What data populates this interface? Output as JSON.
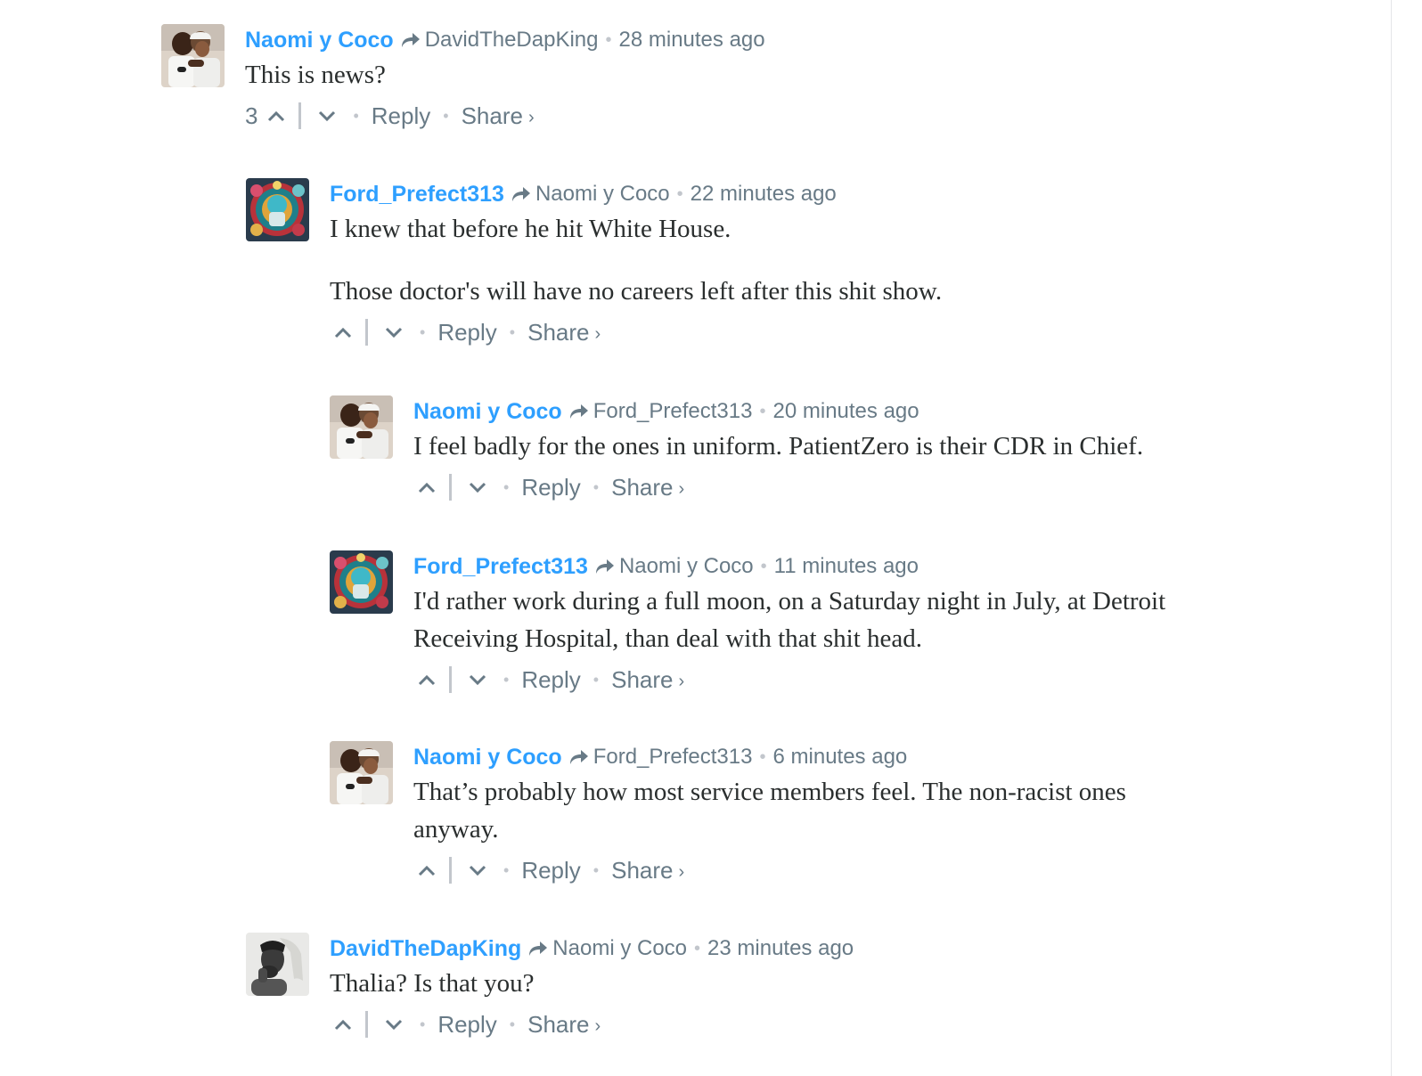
{
  "actions": {
    "reply_label": "Reply",
    "share_label": "Share",
    "share_chevron": "›",
    "separator_dot": "•",
    "upvote_icon": "chevron-up-icon",
    "downvote_icon": "chevron-down-icon"
  },
  "colors": {
    "author_link": "#2e9fff",
    "meta_gray": "#687a86",
    "body_text": "#2a2e2e",
    "divider": "#c2c6cc"
  },
  "comments": [
    {
      "author": "Naomi y Coco",
      "in_reply_to": "DavidTheDapKing",
      "time": "28 minutes ago",
      "paragraphs": [
        "This is news?"
      ],
      "votes": "3",
      "avatar": "tennis-hug-avatar"
    },
    {
      "author": "Ford_Prefect313",
      "in_reply_to": "Naomi y Coco",
      "time": "22 minutes ago",
      "paragraphs": [
        "I knew that before he hit White House.",
        "Those doctor's will have no careers left after this shit show."
      ],
      "votes": "",
      "avatar": "colorful-mask-avatar"
    },
    {
      "author": "Naomi y Coco",
      "in_reply_to": "Ford_Prefect313",
      "time": "20 minutes ago",
      "paragraphs": [
        "I feel badly for the ones in uniform. PatientZero is their CDR in Chief."
      ],
      "votes": "",
      "avatar": "tennis-hug-avatar"
    },
    {
      "author": "Ford_Prefect313",
      "in_reply_to": "Naomi y Coco",
      "time": "11 minutes ago",
      "paragraphs": [
        "I'd rather work during a full moon, on a Saturday night in July, at Detroit Receiving Hospital, than deal with that shit head."
      ],
      "votes": "",
      "avatar": "colorful-mask-avatar"
    },
    {
      "author": "Naomi y Coco",
      "in_reply_to": "Ford_Prefect313",
      "time": "6 minutes ago",
      "paragraphs": [
        "That’s probably how most service members feel. The non-racist ones anyway."
      ],
      "votes": "",
      "avatar": "tennis-hug-avatar"
    },
    {
      "author": "DavidTheDapKing",
      "in_reply_to": "Naomi y Coco",
      "time": "23 minutes ago",
      "paragraphs": [
        "Thalia? Is that you?"
      ],
      "votes": "",
      "avatar": "bw-portrait-avatar"
    }
  ]
}
